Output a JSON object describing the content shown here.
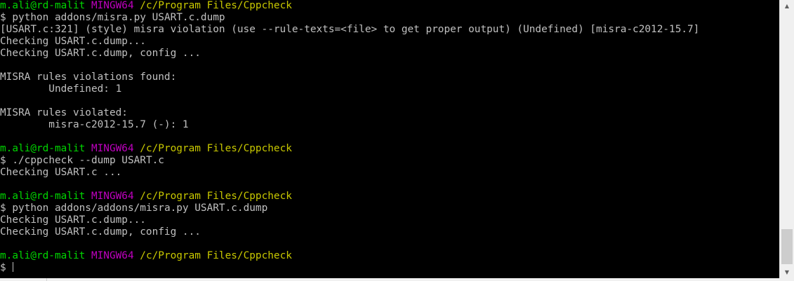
{
  "prompt": {
    "user": "m.ali@rd-malit",
    "host": "MINGW64",
    "cwd": "/c/Program Files/Cppcheck",
    "symbol": "$"
  },
  "lines": [
    {
      "kind": "prompt"
    },
    {
      "kind": "cmd",
      "text": "python addons/misra.py USART.c.dump"
    },
    {
      "kind": "out",
      "text": "[USART.c:321] (style) misra violation (use --rule-texts=<file> to get proper output) (Undefined) [misra-c2012-15.7]"
    },
    {
      "kind": "out",
      "text": "Checking USART.c.dump..."
    },
    {
      "kind": "out",
      "text": "Checking USART.c.dump, config ..."
    },
    {
      "kind": "out",
      "text": ""
    },
    {
      "kind": "out",
      "text": "MISRA rules violations found:"
    },
    {
      "kind": "out",
      "text": "        Undefined: 1"
    },
    {
      "kind": "out",
      "text": ""
    },
    {
      "kind": "out",
      "text": "MISRA rules violated:"
    },
    {
      "kind": "out",
      "text": "        misra-c2012-15.7 (-): 1"
    },
    {
      "kind": "out",
      "text": ""
    },
    {
      "kind": "prompt"
    },
    {
      "kind": "cmd",
      "text": "./cppcheck --dump USART.c"
    },
    {
      "kind": "out",
      "text": "Checking USART.c ..."
    },
    {
      "kind": "out",
      "text": ""
    },
    {
      "kind": "prompt"
    },
    {
      "kind": "cmd",
      "text": "python addons/addons/misra.py USART.c.dump"
    },
    {
      "kind": "out",
      "text": "Checking USART.c.dump..."
    },
    {
      "kind": "out",
      "text": "Checking USART.c.dump, config ..."
    },
    {
      "kind": "out",
      "text": ""
    },
    {
      "kind": "prompt"
    },
    {
      "kind": "input",
      "text": ""
    }
  ],
  "scrollbar": {
    "up_icon": "triangle-up-icon",
    "down_icon": "triangle-down-icon"
  },
  "colors": {
    "background": "#000000",
    "text": "#c0c0c0",
    "user": "#00d600",
    "host": "#bf00bf",
    "cwd": "#c8c800"
  }
}
